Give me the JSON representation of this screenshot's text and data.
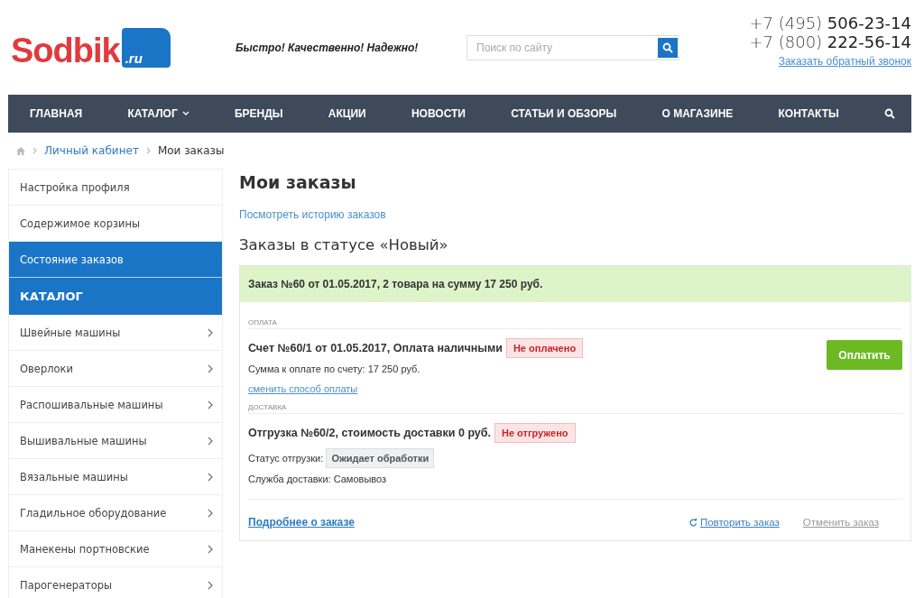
{
  "header": {
    "logo": {
      "name": "Sodbik",
      "domain": ".ru"
    },
    "slogan": "Быстро! Качественно! Надежно!",
    "search": {
      "placeholder": "Поиск по сайту"
    },
    "phones": [
      {
        "code": "+7 (495)",
        "number": "506-23-14"
      },
      {
        "code": "+7 (800)",
        "number": "222-56-14"
      }
    ],
    "callback_link": "Заказать обратный звонок"
  },
  "nav": {
    "items": [
      {
        "label": "ГЛАВНАЯ",
        "has_dropdown": false
      },
      {
        "label": "КАТАЛОГ",
        "has_dropdown": true
      },
      {
        "label": "БРЕНДЫ",
        "has_dropdown": false
      },
      {
        "label": "АКЦИИ",
        "has_dropdown": false
      },
      {
        "label": "НОВОСТИ",
        "has_dropdown": false
      },
      {
        "label": "СТАТЬИ И ОБЗОРЫ",
        "has_dropdown": false
      },
      {
        "label": "О МАГАЗИНЕ",
        "has_dropdown": false
      },
      {
        "label": "КОНТАКТЫ",
        "has_dropdown": false
      }
    ]
  },
  "breadcrumbs": [
    {
      "label": "Личный кабинет",
      "link": true
    },
    {
      "label": "Мои заказы",
      "link": false
    }
  ],
  "sidebar": {
    "account_items": [
      {
        "label": "Настройка профиля",
        "selected": false
      },
      {
        "label": "Содержимое корзины",
        "selected": false
      },
      {
        "label": "Состояние заказов",
        "selected": true
      }
    ],
    "catalog_title": "КАТАЛОГ",
    "catalog_items": [
      "Швейные машины",
      "Оверлоки",
      "Распошивальные машины",
      "Вышивальные машины",
      "Вязальные машины",
      "Гладильное оборудование",
      "Манекены портновские",
      "Парогенераторы"
    ]
  },
  "main": {
    "title": "Мои заказы",
    "history_link": "Посмотреть историю заказов",
    "status_heading": "Заказы в статусе «Новый»",
    "order": {
      "summary": "Заказ №60 от 01.05.2017, 2 товара на сумму 17 250 руб.",
      "payment": {
        "section_label": "ОПЛАТА",
        "title": "Счет №60/1 от 01.05.2017, Оплата наличными",
        "status": "Не оплачено",
        "amount": "Сумма к оплате по счету: 17 250 руб.",
        "change_link": "сменить способ оплаты",
        "pay_button": "Оплатить"
      },
      "delivery": {
        "section_label": "ДОСТАВКА",
        "title": "Отгрузка №60/2, стоимость доставки 0 руб.",
        "status": "Не отгружено",
        "shipment_label": "Статус отгрузки:",
        "shipment_status": "Ожидает обработки",
        "service": "Служба доставки: Самовывоз"
      },
      "details_link": "Подробнее о заказе",
      "repeat_link": "Повторить заказ",
      "cancel_link": "Отменить заказ"
    }
  }
}
